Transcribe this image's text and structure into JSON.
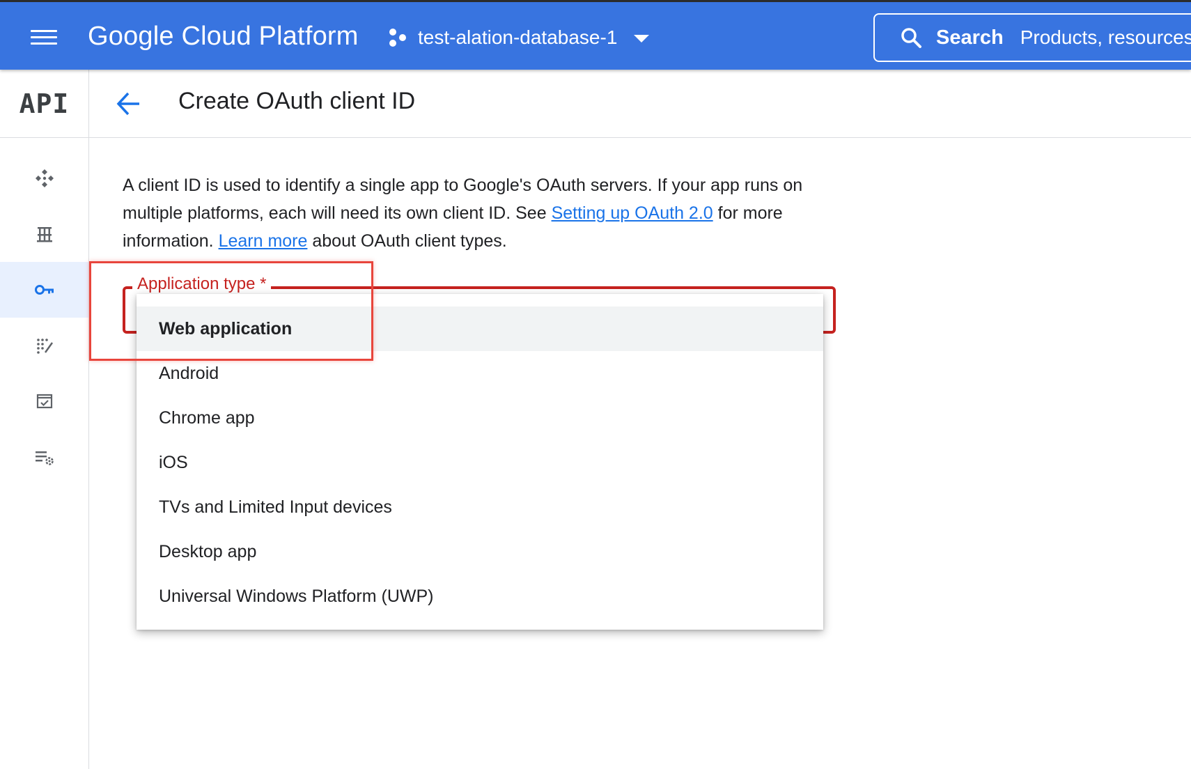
{
  "topbar": {
    "brand": "Google Cloud Platform",
    "project_name": "test-alation-database-1",
    "search_label": "Search",
    "search_placeholder": "Products, resources",
    "background_color": "#3874e0"
  },
  "sidebar": {
    "logo": "API",
    "items": [
      {
        "name": "dashboard-icon",
        "active": false
      },
      {
        "name": "library-icon",
        "active": false
      },
      {
        "name": "credentials-key-icon",
        "active": true
      },
      {
        "name": "oauth-consent-icon",
        "active": false
      },
      {
        "name": "domain-verification-icon",
        "active": false
      },
      {
        "name": "page-settings-icon",
        "active": false
      }
    ]
  },
  "header": {
    "title": "Create OAuth client ID"
  },
  "description": {
    "part1": "A client ID is used to identify a single app to Google's OAuth servers. If your app runs on multiple platforms, each will need its own client ID. See ",
    "link1": "Setting up OAuth 2.0",
    "part2": " for more information. ",
    "link2": "Learn more",
    "part3": " about OAuth client types."
  },
  "application_type": {
    "label": "Application type *",
    "selected": "Web application",
    "options": [
      "Web application",
      "Android",
      "Chrome app",
      "iOS",
      "TVs and Limited Input devices",
      "Desktop app",
      "Universal Windows Platform (UWP)"
    ]
  },
  "colors": {
    "error_red": "#c5221f",
    "link_blue": "#1a73e8",
    "annotation_red": "#e8453c"
  }
}
